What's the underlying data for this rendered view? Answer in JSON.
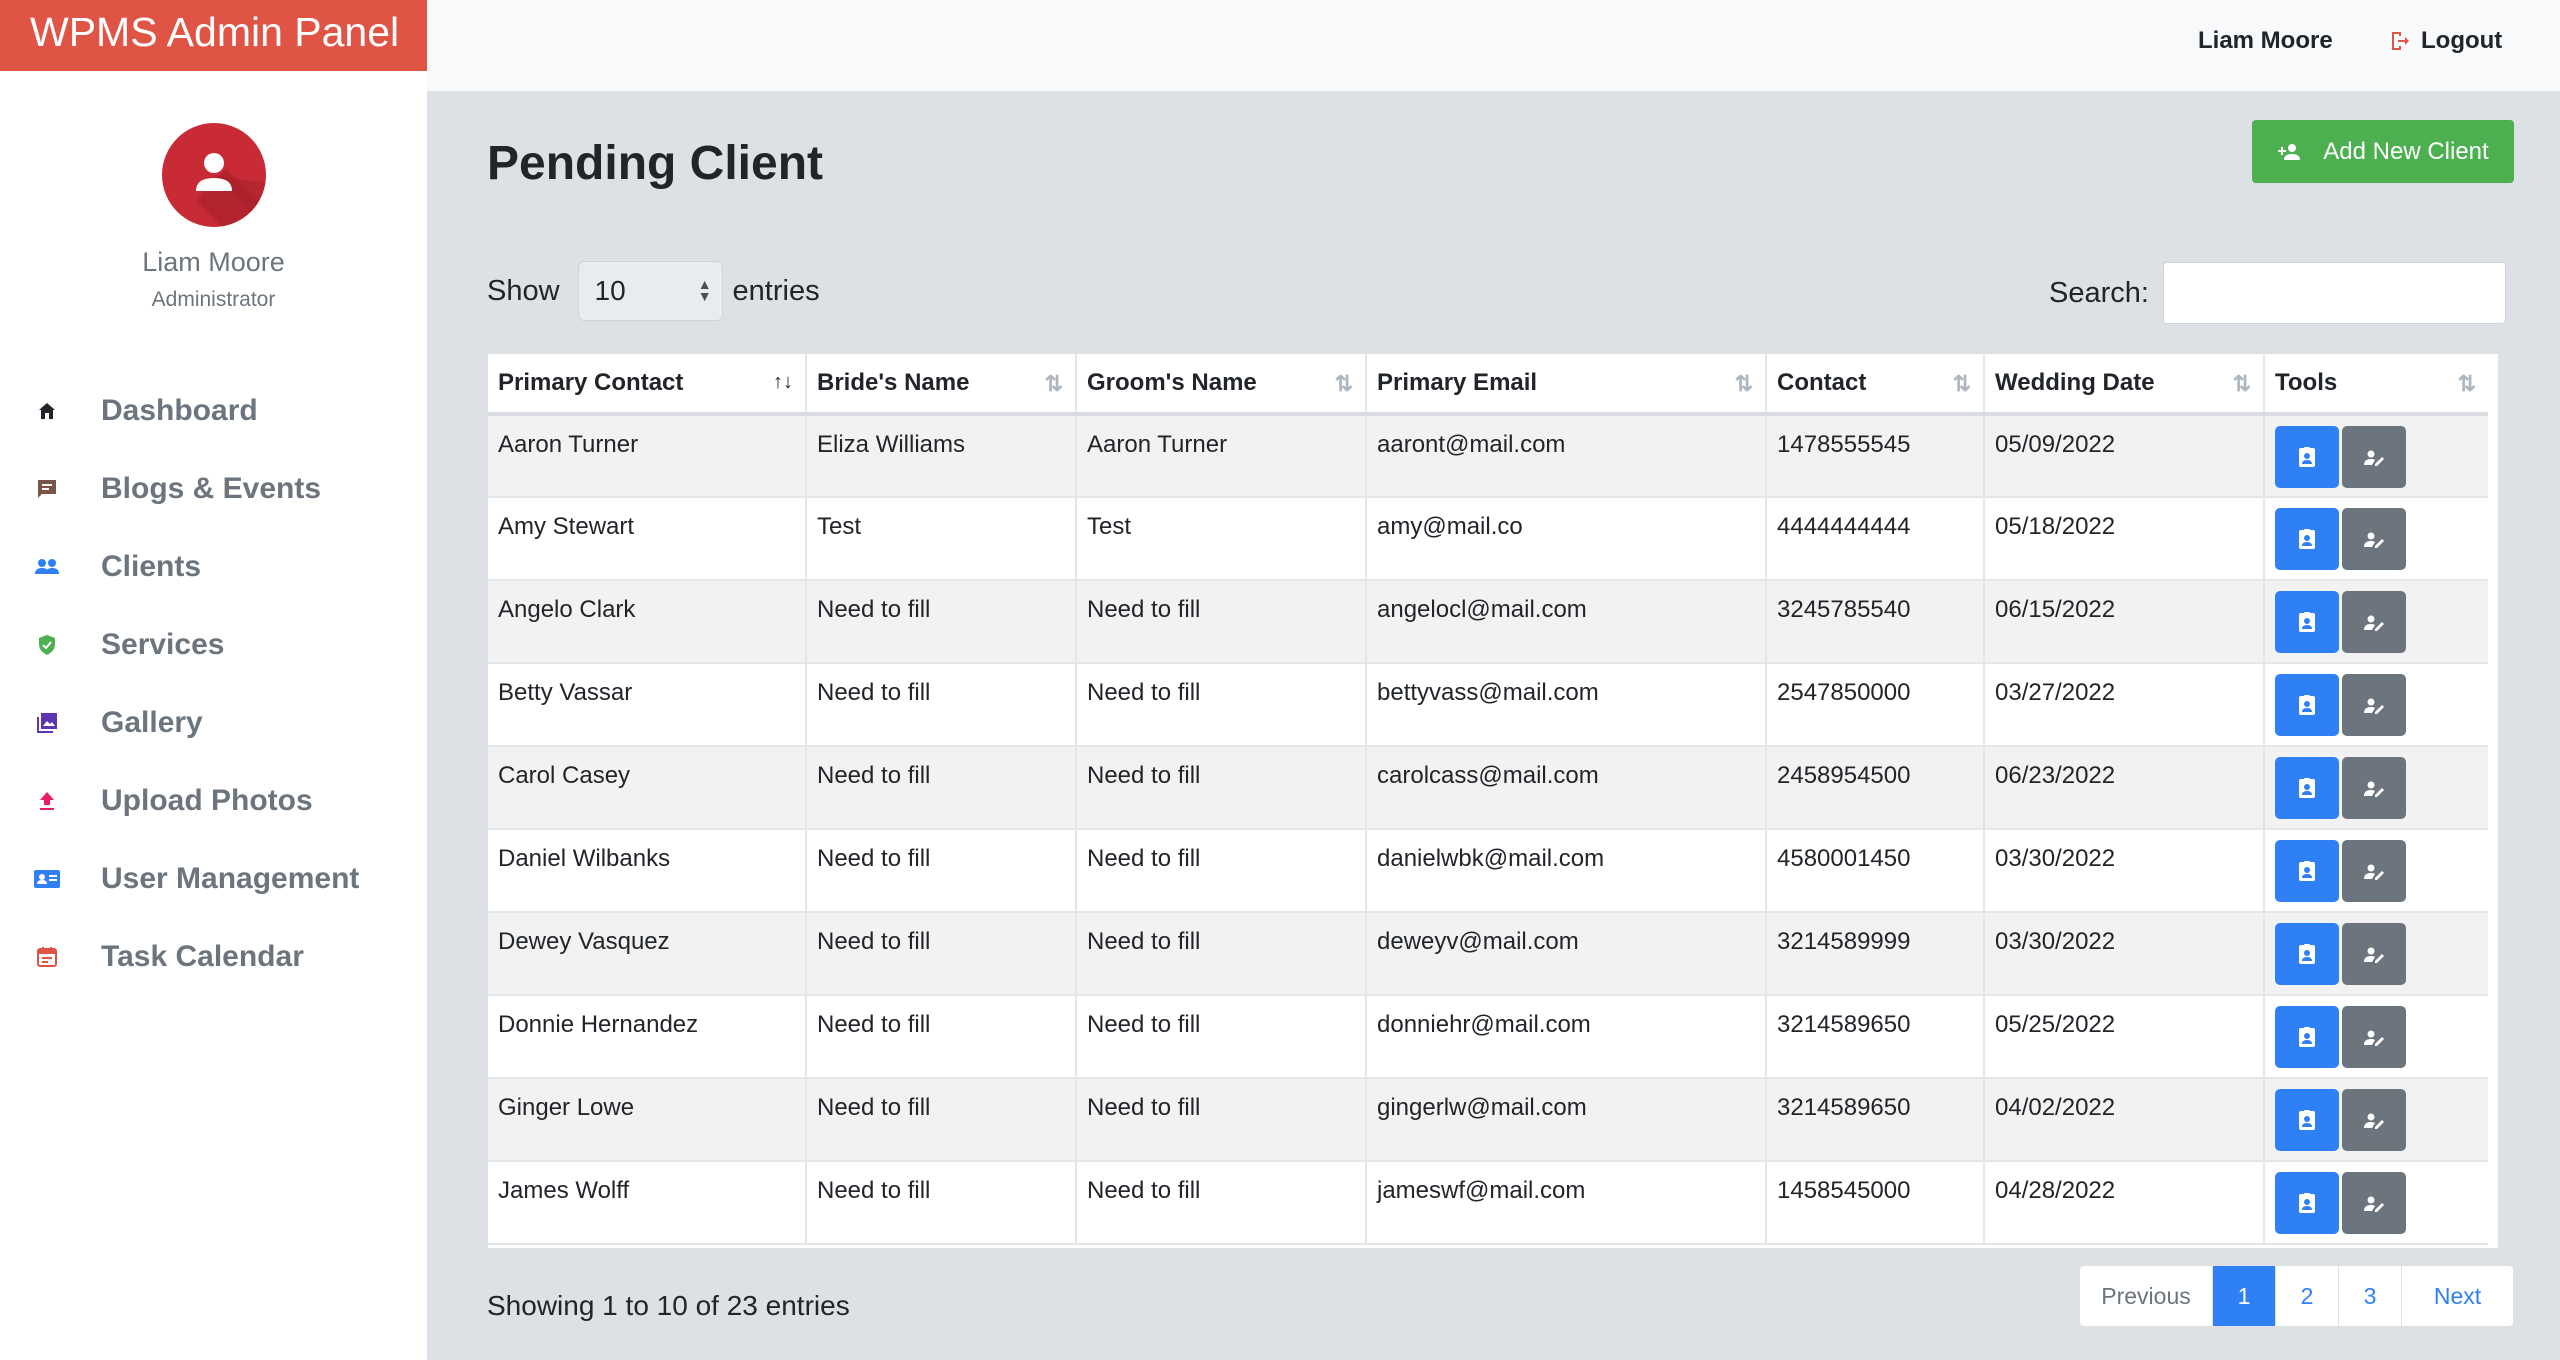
{
  "app": {
    "brand": "WPMS Admin Panel"
  },
  "profile": {
    "name": "Liam Moore",
    "role": "Administrator"
  },
  "sidebar": {
    "items": [
      {
        "label": "Dashboard",
        "icon": "home-icon",
        "color": "#212529"
      },
      {
        "label": "Blogs & Events",
        "icon": "feedback-icon",
        "color": "#795548"
      },
      {
        "label": "Clients",
        "icon": "people-icon",
        "color": "#2f7ff5"
      },
      {
        "label": "Services",
        "icon": "shield-check-icon",
        "color": "#4caf50"
      },
      {
        "label": "Gallery",
        "icon": "photo-library-icon",
        "color": "#5e35b1"
      },
      {
        "label": "Upload Photos",
        "icon": "upload-icon",
        "color": "#e91e63"
      },
      {
        "label": "User Management",
        "icon": "contact-card-icon",
        "color": "#2f7ff5"
      },
      {
        "label": "Task Calendar",
        "icon": "calendar-icon",
        "color": "#e05445"
      }
    ]
  },
  "topbar": {
    "user": "Liam Moore",
    "logout": "Logout"
  },
  "page": {
    "title": "Pending Client",
    "add_button": "Add New Client"
  },
  "controls": {
    "show_label": "Show",
    "entries_label": "entries",
    "page_size": "10",
    "search_label": "Search:",
    "search_value": ""
  },
  "table": {
    "columns": [
      "Primary Contact",
      "Bride's Name",
      "Groom's Name",
      "Primary Email",
      "Contact",
      "Wedding Date",
      "Tools"
    ],
    "sorted_column": 0,
    "rows": [
      [
        "Aaron Turner",
        "Eliza Williams",
        "Aaron Turner",
        "aaront@mail.com",
        "1478555545",
        "05/09/2022"
      ],
      [
        "Amy Stewart",
        "Test",
        "Test",
        "amy@mail.co",
        "4444444444",
        "05/18/2022"
      ],
      [
        "Angelo Clark",
        "Need to fill",
        "Need to fill",
        "angelocl@mail.com",
        "3245785540",
        "06/15/2022"
      ],
      [
        "Betty Vassar",
        "Need to fill",
        "Need to fill",
        "bettyvass@mail.com",
        "2547850000",
        "03/27/2022"
      ],
      [
        "Carol Casey",
        "Need to fill",
        "Need to fill",
        "carolcass@mail.com",
        "2458954500",
        "06/23/2022"
      ],
      [
        "Daniel Wilbanks",
        "Need to fill",
        "Need to fill",
        "danielwbk@mail.com",
        "4580001450",
        "03/30/2022"
      ],
      [
        "Dewey Vasquez",
        "Need to fill",
        "Need to fill",
        "deweyv@mail.com",
        "3214589999",
        "03/30/2022"
      ],
      [
        "Donnie Hernandez",
        "Need to fill",
        "Need to fill",
        "donniehr@mail.com",
        "3214589650",
        "05/25/2022"
      ],
      [
        "Ginger Lowe",
        "Need to fill",
        "Need to fill",
        "gingerlw@mail.com",
        "3214589650",
        "04/02/2022"
      ],
      [
        "James Wolff",
        "Need to fill",
        "Need to fill",
        "jameswf@mail.com",
        "1458545000",
        "04/28/2022"
      ]
    ]
  },
  "footer": {
    "info": "Showing 1 to 10 of 23 entries",
    "prev": "Previous",
    "pages": [
      "1",
      "2",
      "3"
    ],
    "active_page": "1",
    "next": "Next"
  },
  "colors": {
    "brand": "#e05445",
    "primary": "#2f7ff5",
    "success": "#4caf50",
    "secondary": "#6c757d"
  }
}
